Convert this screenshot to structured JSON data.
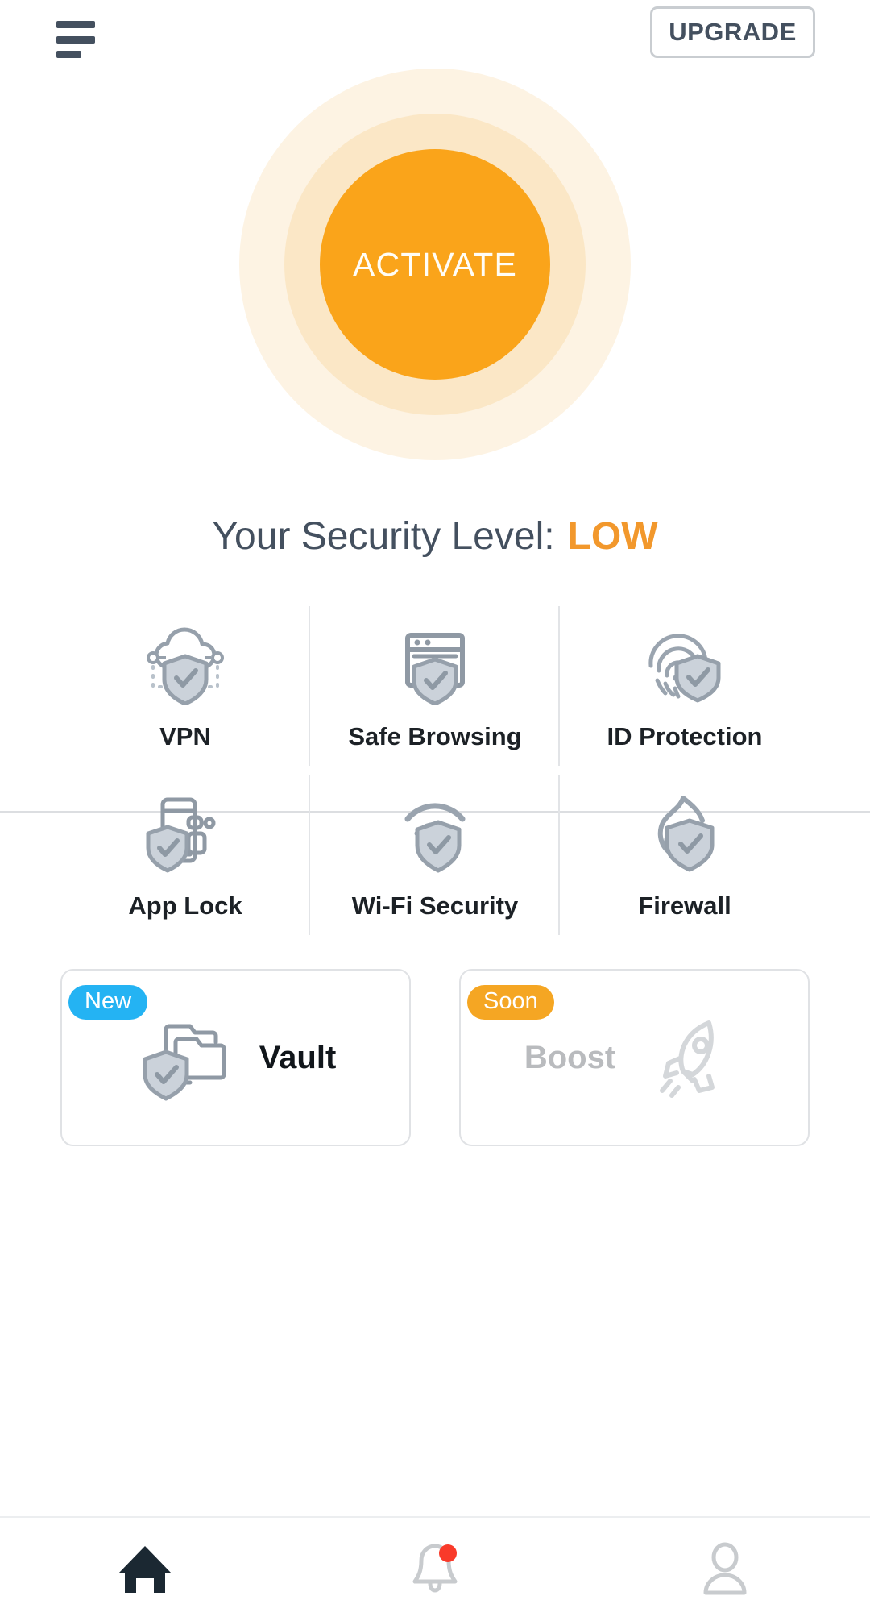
{
  "header": {
    "menu_icon": "hamburger-menu-icon",
    "upgrade_label": "UPGRADE"
  },
  "activate": {
    "label": "ACTIVATE",
    "core_color": "#faa41a",
    "mid_ring_color": "#fbe7c6",
    "outer_ring_color": "#fdf3e3"
  },
  "security_level": {
    "label": "Your Security Level:",
    "value": "LOW",
    "value_color": "#f2982c",
    "label_color": "#44505f"
  },
  "features": [
    {
      "label": "VPN",
      "icon": "cloud-shield-icon"
    },
    {
      "label": "Safe Browsing",
      "icon": "browser-shield-icon"
    },
    {
      "label": "ID Protection",
      "icon": "fingerprint-shield-icon"
    },
    {
      "label": "App Lock",
      "icon": "phone-apps-shield-icon"
    },
    {
      "label": "Wi-Fi Security",
      "icon": "wifi-shield-icon"
    },
    {
      "label": "Firewall",
      "icon": "flame-shield-icon"
    }
  ],
  "cards": [
    {
      "label": "Vault",
      "badge": "New",
      "badge_color": "#24b3f3",
      "icon": "folders-shield-icon",
      "disabled": false
    },
    {
      "label": "Boost",
      "badge": "Soon",
      "badge_color": "#f5a623",
      "icon": "rocket-icon",
      "disabled": true
    }
  ],
  "bottom_nav": [
    {
      "icon": "home-icon",
      "active": true,
      "badge": false
    },
    {
      "icon": "bell-icon",
      "active": false,
      "badge": true,
      "badge_color": "#f93a2a"
    },
    {
      "icon": "profile-icon",
      "active": false,
      "badge": false
    }
  ]
}
